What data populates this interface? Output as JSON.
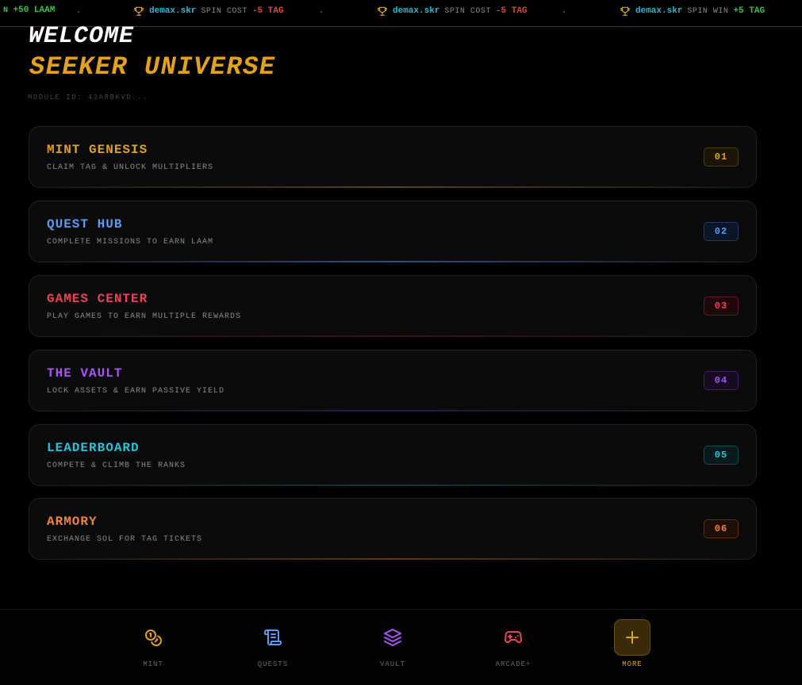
{
  "ticker": [
    {
      "prefix": "N",
      "amount": "+50 LAAM",
      "amount_color": "pos"
    },
    {
      "user": "demax.skr",
      "action": "SPIN COST",
      "amount": "-5 TAG",
      "amount_color": "neg"
    },
    {
      "user": "demax.skr",
      "action": "SPIN COST",
      "amount": "-5 TAG",
      "amount_color": "neg"
    },
    {
      "user": "demax.skr",
      "action": "SPIN WIN",
      "amount": "+5 TAG",
      "amount_color": "pos"
    }
  ],
  "header": {
    "welcome": "WELCOME",
    "universe": "SEEKER UNIVERSE",
    "module_id": "MODULE ID: 43ARBKVD..."
  },
  "modules": [
    {
      "title": "MINT GENESIS",
      "desc": "CLAIM TAG & UNLOCK MULTIPLIERS",
      "num": "01",
      "color": "#e2a21c"
    },
    {
      "title": "QUEST HUB",
      "desc": "COMPLETE MISSIONS TO EARN LAAM",
      "num": "02",
      "color": "#5b9cf0"
    },
    {
      "title": "GAMES CENTER",
      "desc": "PLAY GAMES TO EARN MULTIPLE REWARDS",
      "num": "03",
      "color": "#ef4258"
    },
    {
      "title": "THE VAULT",
      "desc": "LOCK ASSETS & EARN PASSIVE YIELD",
      "num": "04",
      "color": "#a855f7"
    },
    {
      "title": "LEADERBOARD",
      "desc": "COMPETE & CLIMB THE RANKS",
      "num": "05",
      "color": "#22c4dc"
    },
    {
      "title": "ARMORY",
      "desc": "EXCHANGE SOL FOR TAG TICKETS",
      "num": "06",
      "color": "#f0843c"
    }
  ],
  "nav": [
    {
      "label": "MINT",
      "icon": "coins-icon",
      "color": "#e2a21c"
    },
    {
      "label": "QUESTS",
      "icon": "scroll-icon",
      "color": "#5b9cf0"
    },
    {
      "label": "VAULT",
      "icon": "layers-icon",
      "color": "#a855f7"
    },
    {
      "label": "ARCADE+",
      "icon": "gamepad-icon",
      "color": "#ef4258"
    },
    {
      "label": "MORE",
      "icon": "plus-icon",
      "color": "#e2a21c",
      "active": true
    }
  ]
}
